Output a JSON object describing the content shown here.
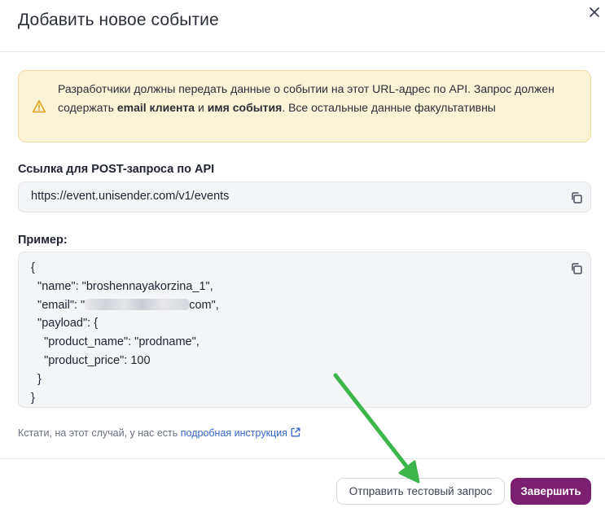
{
  "dialog": {
    "title": "Добавить новое событие"
  },
  "alert": {
    "text_part1": "Разработчики должны передать данные о событии на этот URL-адрес по API. Запрос должен содержать ",
    "bold1": "email клиента",
    "text_part2": " и ",
    "bold2": "имя события",
    "text_part3": ". Все остальные данные факультативны"
  },
  "api_url": {
    "label": "Ссылка для POST-запроса по API",
    "value": "https://event.unisender.com/v1/events"
  },
  "example": {
    "label": "Пример:",
    "lines": {
      "l1": "{",
      "l2": "  \"name\": \"broshennayakorzina_1\",",
      "l3_start": "  \"email\": \"",
      "l3_end": "com\",",
      "l4": "  \"payload\": {",
      "l5": "    \"product_name\": \"prodname\",",
      "l6": "    \"product_price\": 100",
      "l7": "  }",
      "l8": "}"
    }
  },
  "hint": {
    "text": "Кстати, на этот случай, у нас есть ",
    "link": "подробная инструкция"
  },
  "footer": {
    "secondary_label": "Отправить тестовый запрос",
    "primary_label": "Завершить"
  },
  "colors": {
    "primary": "#7b1f6f",
    "alert_bg": "#fbf3d6",
    "link": "#3567c9",
    "annotation_arrow": "#3cb54a"
  },
  "icons": {
    "close": "close-icon",
    "warning": "warning-icon",
    "copy": "copy-icon",
    "external": "external-link-icon"
  }
}
